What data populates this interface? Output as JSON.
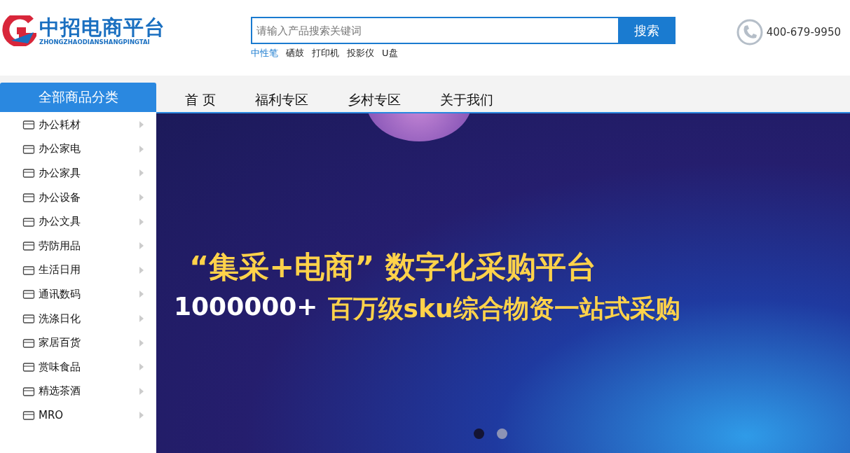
{
  "logo": {
    "title": "中招电商平台",
    "subtitle": "ZHONGZHAODIANSHANGPINGTAI"
  },
  "search": {
    "placeholder": "请输入产品搜索关键词",
    "button": "搜索"
  },
  "hot_keywords": [
    {
      "label": "中性笔",
      "selected": true
    },
    {
      "label": "硒鼓",
      "selected": false
    },
    {
      "label": "打印机",
      "selected": false
    },
    {
      "label": "投影仪",
      "selected": false
    },
    {
      "label": "U盘",
      "selected": false
    }
  ],
  "phone": "400-679-9950",
  "category_button": "全部商品分类",
  "nav": [
    {
      "label": "首 页"
    },
    {
      "label": "福利专区"
    },
    {
      "label": "乡村专区"
    },
    {
      "label": "关于我们"
    }
  ],
  "categories": [
    {
      "label": "办公耗材"
    },
    {
      "label": "办公家电"
    },
    {
      "label": "办公家具"
    },
    {
      "label": "办公设备"
    },
    {
      "label": "办公文具"
    },
    {
      "label": "劳防用品"
    },
    {
      "label": "生活日用"
    },
    {
      "label": "通讯数码"
    },
    {
      "label": "洗涤日化"
    },
    {
      "label": "家居百货"
    },
    {
      "label": "赏味食品"
    },
    {
      "label": "精选茶酒"
    },
    {
      "label": "MRO"
    }
  ],
  "banner": {
    "headline": "“集采+电商” 数字化采购平台",
    "count": "1000000+",
    "tagline": "百万级sku综合物资一站式采购",
    "dots": [
      {
        "selected": true
      },
      {
        "selected": false
      }
    ]
  }
}
